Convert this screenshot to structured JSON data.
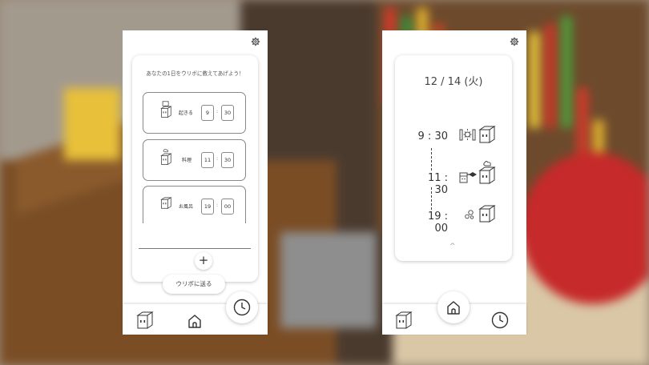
{
  "left_screen": {
    "intro_text": "あなたの1日をウリボに教えてあげよう！",
    "items": [
      {
        "label": "起きる",
        "hour": "9",
        "minute": "30"
      },
      {
        "label": "料理",
        "hour": "11",
        "minute": "30"
      },
      {
        "label": "お風呂",
        "hour": "19",
        "minute": "00"
      }
    ],
    "add_label": "+",
    "send_label": "ウリボに送る"
  },
  "right_screen": {
    "date": "12 / 14 (火)",
    "schedule": [
      {
        "time": "9 : 30",
        "icon": "sun-window-icon"
      },
      {
        "time": "11 : 30",
        "icon": "stove-icon"
      },
      {
        "time": "19 : 00",
        "icon": "bubbles-icon"
      }
    ],
    "chevron": "^"
  },
  "icons": {
    "settings": "gear-icon",
    "character": "cube-character-icon",
    "home": "home-icon",
    "clock": "clock-icon"
  },
  "colors": {
    "accent": "#333333",
    "card": "#ffffff",
    "border": "#888888"
  }
}
